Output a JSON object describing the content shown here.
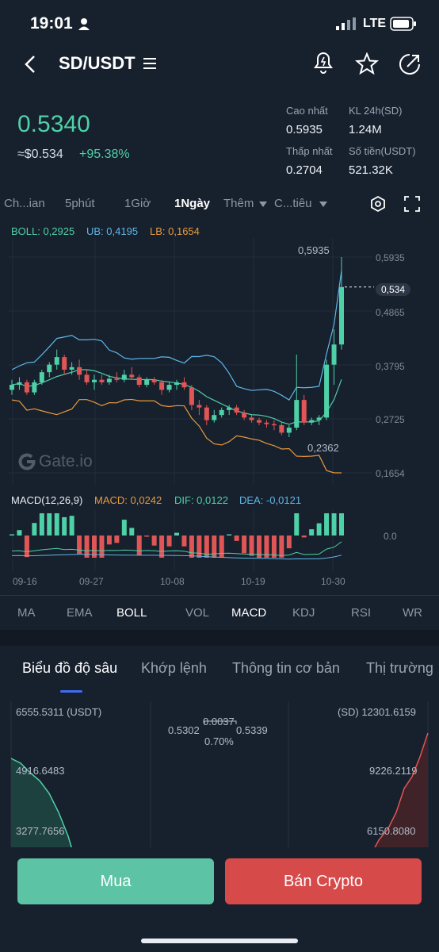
{
  "status_bar": {
    "time": "19:01",
    "network": "LTE"
  },
  "header": {
    "pair": "SD/USDT"
  },
  "ticker": {
    "price": "0.5340",
    "approx": "≈$0.534",
    "change": "+95.38%",
    "high_label": "Cao nhất",
    "high_value": "0.5935",
    "vol_label": "KL 24h(SD)",
    "vol_value": "1.24M",
    "low_label": "Thấp nhất",
    "low_value": "0.2704",
    "turnover_label": "Số tiền(USDT)",
    "turnover_value": "521.32K"
  },
  "interval_tabs": [
    "Ch...ian",
    "5phút",
    "1Giờ",
    "1Ngày",
    "Thêm",
    "C...tiêu"
  ],
  "boll": {
    "boll": "BOLL: 0,2925",
    "ub": "UB: 0,4195",
    "lb": "LB: 0,1654"
  },
  "price_axis": [
    "0,5935",
    "0,4865",
    "0,3795",
    "0,2725",
    "0,1654"
  ],
  "high_marker": "0,5935",
  "low_marker": "0,2362",
  "last_price_tag": "0,534",
  "watermark": "Gate.io",
  "macd": {
    "title": "MACD(12,26,9)",
    "macd": "MACD: 0,0242",
    "dif": "DIF: 0,0122",
    "dea": "DEA: -0,0121",
    "zero": "0.0"
  },
  "date_axis": [
    "09-16",
    "09-27",
    "10-08",
    "10-19",
    "10-30"
  ],
  "indicator_tabs": [
    "MA",
    "EMA",
    "BOLL",
    "VOL",
    "MACD",
    "KDJ",
    "RSI",
    "WR"
  ],
  "detail_tabs": [
    "Biểu đồ độ sâu",
    "Khớp lệnh",
    "Thông tin cơ bản",
    "Thị trường"
  ],
  "depth": {
    "left_top": "6555.5311 (USDT)",
    "left_mid": "4916.6483",
    "left_bottom": "3277.7656",
    "right_top": "(SD) 12301.6159",
    "right_mid": "9226.2119",
    "right_bottom": "6150.8080",
    "bid": "0.5302",
    "spread": "0.0037",
    "ask": "0.5339",
    "spread_pct": "0.70%"
  },
  "buttons": {
    "buy": "Mua",
    "sell": "Bán Crypto"
  },
  "colors": {
    "up": "#4fd1a8",
    "down": "#e05656",
    "buy_btn": "#5cc4a4",
    "sell_btn": "#d74a4a"
  },
  "chart_data": {
    "type": "candlestick",
    "x": [
      "09-16",
      "09-17",
      "09-18",
      "09-19",
      "09-20",
      "09-21",
      "09-22",
      "09-23",
      "09-24",
      "09-25",
      "09-26",
      "09-27",
      "09-28",
      "09-29",
      "09-30",
      "10-01",
      "10-02",
      "10-03",
      "10-04",
      "10-05",
      "10-06",
      "10-07",
      "10-08",
      "10-09",
      "10-10",
      "10-11",
      "10-12",
      "10-13",
      "10-14",
      "10-15",
      "10-16",
      "10-17",
      "10-18",
      "10-19",
      "10-20",
      "10-21",
      "10-22",
      "10-23",
      "10-24",
      "10-25",
      "10-26",
      "10-27",
      "10-28",
      "10-29",
      "10-30"
    ],
    "series": [
      {
        "name": "candles",
        "ohlc": [
          [
            0.33,
            0.35,
            0.32,
            0.34
          ],
          [
            0.34,
            0.355,
            0.33,
            0.345
          ],
          [
            0.345,
            0.35,
            0.32,
            0.325
          ],
          [
            0.325,
            0.35,
            0.32,
            0.345
          ],
          [
            0.345,
            0.37,
            0.34,
            0.365
          ],
          [
            0.365,
            0.385,
            0.355,
            0.38
          ],
          [
            0.38,
            0.41,
            0.37,
            0.395
          ],
          [
            0.395,
            0.4,
            0.36,
            0.37
          ],
          [
            0.37,
            0.385,
            0.36,
            0.375
          ],
          [
            0.375,
            0.39,
            0.35,
            0.36
          ],
          [
            0.36,
            0.37,
            0.34,
            0.345
          ],
          [
            0.345,
            0.36,
            0.33,
            0.35
          ],
          [
            0.35,
            0.36,
            0.34,
            0.345
          ],
          [
            0.345,
            0.36,
            0.34,
            0.352
          ],
          [
            0.352,
            0.365,
            0.345,
            0.35
          ],
          [
            0.35,
            0.37,
            0.345,
            0.36
          ],
          [
            0.36,
            0.375,
            0.35,
            0.355
          ],
          [
            0.355,
            0.36,
            0.335,
            0.34
          ],
          [
            0.34,
            0.355,
            0.335,
            0.35
          ],
          [
            0.35,
            0.355,
            0.34,
            0.345
          ],
          [
            0.345,
            0.35,
            0.32,
            0.33
          ],
          [
            0.33,
            0.345,
            0.325,
            0.34
          ],
          [
            0.34,
            0.35,
            0.33,
            0.345
          ],
          [
            0.345,
            0.355,
            0.33,
            0.335
          ],
          [
            0.335,
            0.34,
            0.29,
            0.3
          ],
          [
            0.3,
            0.31,
            0.28,
            0.295
          ],
          [
            0.295,
            0.3,
            0.26,
            0.27
          ],
          [
            0.27,
            0.29,
            0.265,
            0.28
          ],
          [
            0.28,
            0.295,
            0.275,
            0.29
          ],
          [
            0.29,
            0.3,
            0.28,
            0.295
          ],
          [
            0.295,
            0.3,
            0.28,
            0.285
          ],
          [
            0.285,
            0.29,
            0.27,
            0.275
          ],
          [
            0.275,
            0.28,
            0.265,
            0.27
          ],
          [
            0.27,
            0.275,
            0.26,
            0.265
          ],
          [
            0.265,
            0.27,
            0.255,
            0.262
          ],
          [
            0.262,
            0.27,
            0.25,
            0.26
          ],
          [
            0.26,
            0.265,
            0.24,
            0.245
          ],
          [
            0.245,
            0.26,
            0.2362,
            0.255
          ],
          [
            0.255,
            0.4,
            0.25,
            0.31
          ],
          [
            0.31,
            0.32,
            0.26,
            0.265
          ],
          [
            0.265,
            0.275,
            0.26,
            0.27
          ],
          [
            0.27,
            0.28,
            0.26,
            0.275
          ],
          [
            0.275,
            0.39,
            0.27,
            0.38
          ],
          [
            0.38,
            0.45,
            0.34,
            0.42
          ],
          [
            0.42,
            0.5935,
            0.41,
            0.534
          ]
        ]
      }
    ],
    "ylim": [
      0.1654,
      0.5935
    ]
  }
}
